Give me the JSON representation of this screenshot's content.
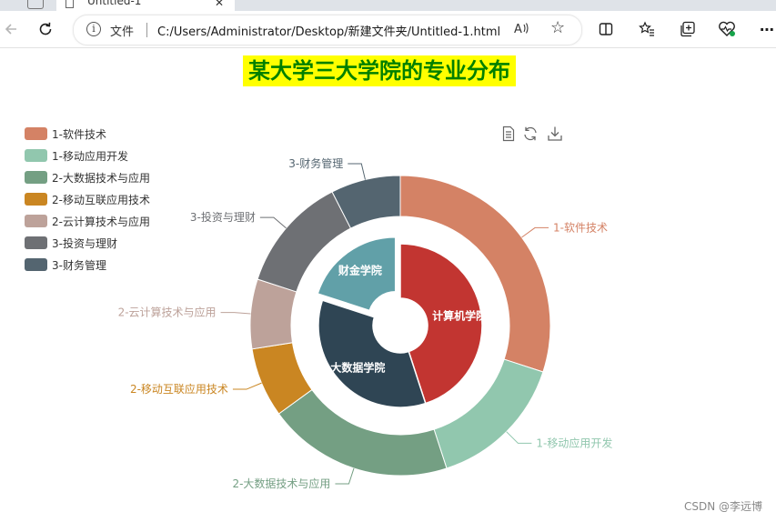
{
  "browser": {
    "tab_title": "Untitled-1.html",
    "site_label": "文件",
    "url": "C:/Users/Administrator/Desktop/新建文件夹/Untitled-1.html",
    "read_aloud": "A⁾"
  },
  "chart_data": {
    "type": "pie",
    "title": "某大学三大学院的专业分布",
    "title_color": "#008000",
    "title_background": "#ffff00",
    "inner": [
      {
        "name": "计算机学院",
        "value": 90,
        "color": "#c23531"
      },
      {
        "name": "大数据学院",
        "value": 70,
        "color": "#2f4554"
      },
      {
        "name": "财金学院",
        "value": 40,
        "color": "#61a0a8"
      }
    ],
    "outer": [
      {
        "name": "1-软件技术",
        "value": 60,
        "color": "#d48265"
      },
      {
        "name": "1-移动应用开发",
        "value": 30,
        "color": "#91c7ae"
      },
      {
        "name": "2-大数据技术与应用",
        "value": 40,
        "color": "#749f83"
      },
      {
        "name": "2-移动互联应用技术",
        "value": 15,
        "color": "#ca8622"
      },
      {
        "name": "2-云计算技术与应用",
        "value": 15,
        "color": "#bda29a"
      },
      {
        "name": "3-投资与理财",
        "value": 25,
        "color": "#6e7074"
      },
      {
        "name": "3-财务管理",
        "value": 15,
        "color": "#546570"
      }
    ],
    "legend_position": "top-left"
  },
  "legend": {
    "items": [
      {
        "label": "1-软件技术",
        "color": "#d48265"
      },
      {
        "label": "1-移动应用开发",
        "color": "#91c7ae"
      },
      {
        "label": "2-大数据技术与应用",
        "color": "#749f83"
      },
      {
        "label": "2-移动互联应用技术",
        "color": "#ca8622"
      },
      {
        "label": "2-云计算技术与应用",
        "color": "#bda29a"
      },
      {
        "label": "3-投资与理财",
        "color": "#6e7074"
      },
      {
        "label": "3-财务管理",
        "color": "#546570"
      }
    ]
  },
  "toolbox": {
    "icons": [
      "data-view-icon",
      "restore-icon",
      "save-image-icon"
    ]
  },
  "watermark": "CSDN @李远博"
}
